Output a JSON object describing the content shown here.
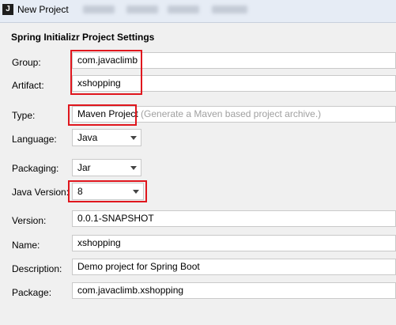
{
  "window": {
    "title": "New Project",
    "app_icon": "intellij-icon"
  },
  "section": {
    "title": "Spring Initializr Project Settings"
  },
  "fields": {
    "group": {
      "label": "Group:",
      "value": "com.javaclimb"
    },
    "artifact": {
      "label": "Artifact:",
      "value": "xshopping"
    },
    "type": {
      "label": "Type:",
      "value": "Maven Project",
      "hint": "(Generate a Maven based project archive.)"
    },
    "language": {
      "label": "Language:",
      "value": "Java"
    },
    "packaging": {
      "label": "Packaging:",
      "value": "Jar"
    },
    "java_version": {
      "label": "Java Version:",
      "value": "8"
    },
    "version": {
      "label": "Version:",
      "value": "0.0.1-SNAPSHOT"
    },
    "name": {
      "label": "Name:",
      "value": "xshopping"
    },
    "description": {
      "label": "Description:",
      "value": "Demo project for Spring Boot"
    },
    "package": {
      "label": "Package:",
      "value": "com.javaclimb.xshopping"
    }
  },
  "colors": {
    "highlight": "#e0161d",
    "titlebar": "#e6ecf5",
    "background": "#f0f0f0"
  }
}
